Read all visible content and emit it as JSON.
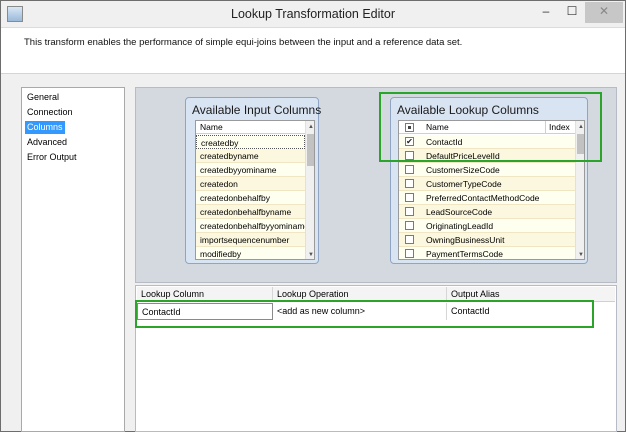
{
  "window": {
    "title": "Lookup Transformation Editor",
    "controls": {
      "minimize": "–",
      "maximize": "☐",
      "close": "✕"
    }
  },
  "description": "This transform enables the performance of simple equi-joins between the input and a reference data set.",
  "nav": {
    "items": [
      "General",
      "Connection",
      "Columns",
      "Advanced",
      "Error Output"
    ],
    "selected": "Columns"
  },
  "input_columns": {
    "title": "Available Input Columns",
    "header": "Name",
    "rows": [
      "createdby",
      "createdbyname",
      "createdbyyominame",
      "createdon",
      "createdonbehalfby",
      "createdonbehalfbyname",
      "createdonbehalfbyyominame",
      "importsequencenumber",
      "modifiedby"
    ]
  },
  "lookup_columns": {
    "title": "Available Lookup Columns",
    "header_name": "Name",
    "header_index": "Index",
    "rows": [
      {
        "name": "ContactId",
        "checked": true
      },
      {
        "name": "DefaultPriceLevelId",
        "checked": false
      },
      {
        "name": "CustomerSizeCode",
        "checked": false
      },
      {
        "name": "CustomerTypeCode",
        "checked": false
      },
      {
        "name": "PreferredContactMethodCode",
        "checked": false
      },
      {
        "name": "LeadSourceCode",
        "checked": false
      },
      {
        "name": "OriginatingLeadId",
        "checked": false
      },
      {
        "name": "OwningBusinessUnit",
        "checked": false
      },
      {
        "name": "PaymentTermsCode",
        "checked": false
      }
    ]
  },
  "mapping_table": {
    "headers": [
      "Lookup Column",
      "Lookup Operation",
      "Output Alias"
    ],
    "rows": [
      [
        "ContactId",
        "<add as new column>",
        "ContactId"
      ]
    ]
  },
  "colors": {
    "highlight": "#2aa52a",
    "selection": "#3399ff"
  }
}
